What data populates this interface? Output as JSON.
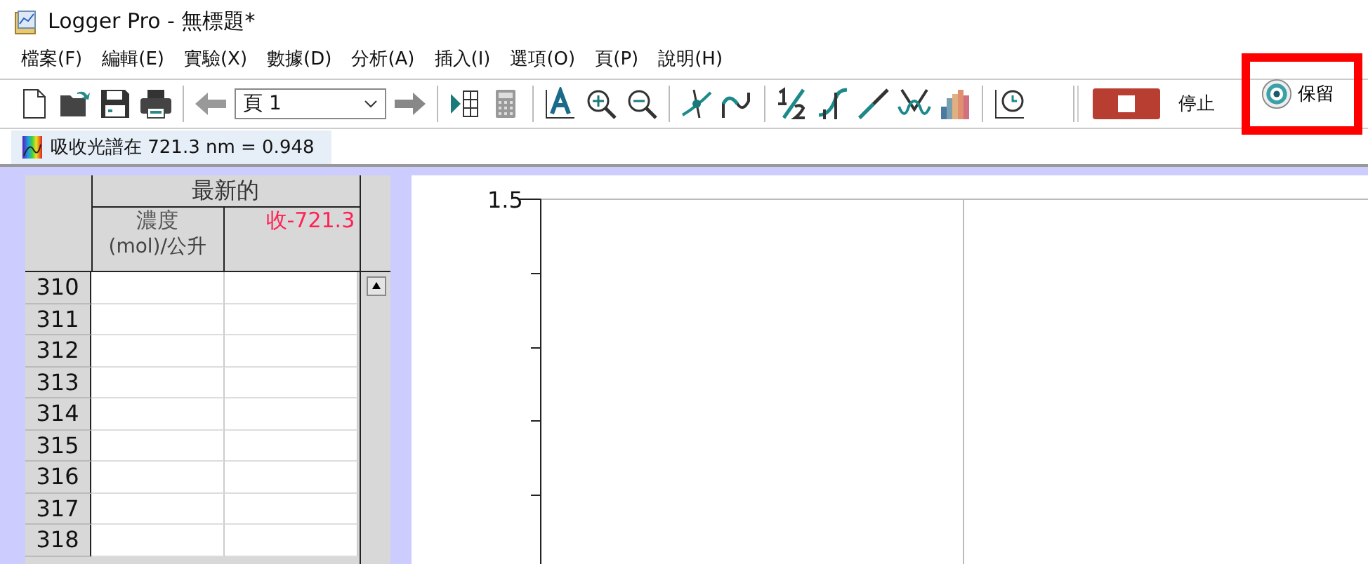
{
  "window": {
    "title": "Logger Pro - 無標題*"
  },
  "menu": [
    "檔案(F)",
    "編輯(E)",
    "實驗(X)",
    "數據(D)",
    "分析(A)",
    "插入(I)",
    "選項(O)",
    "頁(P)",
    "說明(H)"
  ],
  "toolbar": {
    "page_select": "頁 1",
    "stop_label": "停止",
    "keep_label": "保留"
  },
  "readout": "吸收光譜在 721.3 nm = 0.948",
  "table": {
    "group": "最新的",
    "columns": [
      {
        "name": "濃度",
        "units": "(mol)/公升",
        "color": "#555555"
      },
      {
        "name": "收-721.3",
        "color": "#ff2255"
      }
    ],
    "rows": [
      "310",
      "311",
      "312",
      "313",
      "314",
      "315",
      "316",
      "317",
      "318"
    ]
  },
  "graph": {
    "y_tick_label": "1.5"
  }
}
